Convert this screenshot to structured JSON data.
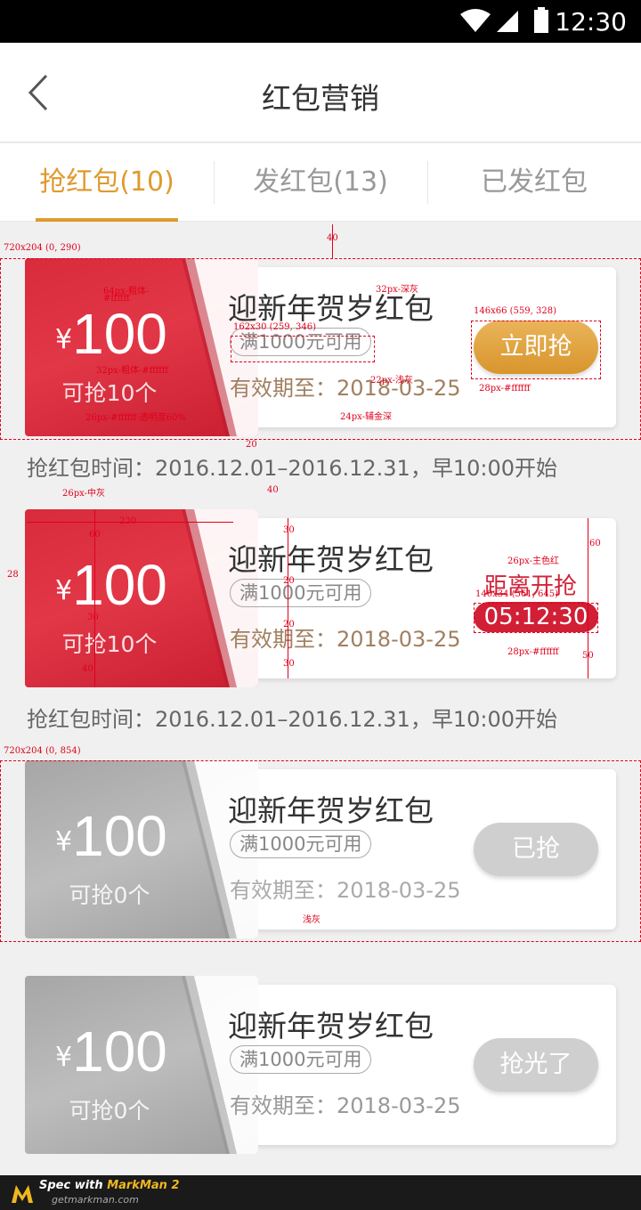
{
  "status_bar": {
    "time": "12:30"
  },
  "header": {
    "title": "红包营销"
  },
  "tabs": [
    {
      "label": "抢红包(10)",
      "active": true
    },
    {
      "label": "发红包(13)",
      "active": false
    },
    {
      "label": "已发红包",
      "active": false
    }
  ],
  "cards": [
    {
      "currency": "¥",
      "amount": "100",
      "remaining": "可抢10个",
      "name": "迎新年贺岁红包",
      "condition": "满1000元可用",
      "valid_label": "有效期至：",
      "valid_date": "2018-03-25",
      "button": "立即抢",
      "time_line": "抢红包时间：2016.12.01–2016.12.31，早10:00开始"
    },
    {
      "currency": "¥",
      "amount": "100",
      "remaining": "可抢10个",
      "name": "迎新年贺岁红包",
      "condition": "满1000元可用",
      "valid_label": "有效期至：",
      "valid_date": "2018-03-25",
      "countdown_label": "距离开抢",
      "countdown": "05:12:30",
      "time_line": "抢红包时间：2016.12.01–2016.12.31，早10:00开始"
    },
    {
      "currency": "¥",
      "amount": "100",
      "remaining": "可抢0个",
      "name": "迎新年贺岁红包",
      "condition": "满1000元可用",
      "valid_label": "有效期至：",
      "valid_date": "2018-03-25",
      "button": "已抢"
    },
    {
      "currency": "¥",
      "amount": "100",
      "remaining": "可抢0个",
      "name": "迎新年贺岁红包",
      "condition": "满1000元可用",
      "valid_label": "有效期至：",
      "valid_date": "2018-03-25",
      "button": "抢光了"
    }
  ],
  "annotations": {
    "a1": "720x204 (0, 290)",
    "a2": "40",
    "a3": "64px-粗体-",
    "a4": "#ffffff",
    "a5": "32px-深灰",
    "a6": "146x66 (559, 328)",
    "a7": "162x30 (259, 346)",
    "a8": "32px-粗体-#ffffff",
    "a9": "22px-浅灰",
    "a10": "28px-#ffffff",
    "a11": "26px-#ffffff-透明度60%",
    "a12": "24px-辅金深",
    "a13": "20",
    "a14": "26px-中灰",
    "a15": "40",
    "a16": "230",
    "a17": "60",
    "a18": "28",
    "a19": "30",
    "a20": "20",
    "a21": "20",
    "a22": "30",
    "a23": "26px-主色红",
    "a24": "60",
    "a25": "140x34 (561, 645)",
    "a26": "28px-#ffffff",
    "a27": "50",
    "a28": "30",
    "a29": "40",
    "a30": "720x204 (0, 854)",
    "a31": "浅灰"
  },
  "footer": {
    "brand_prefix": "Spec with ",
    "brand": "MarkMan 2",
    "site": "getmarkman.com"
  },
  "colors": {
    "accent": "#e09a2e",
    "red": "#d82b3c",
    "gold_button": "#d8952c"
  }
}
